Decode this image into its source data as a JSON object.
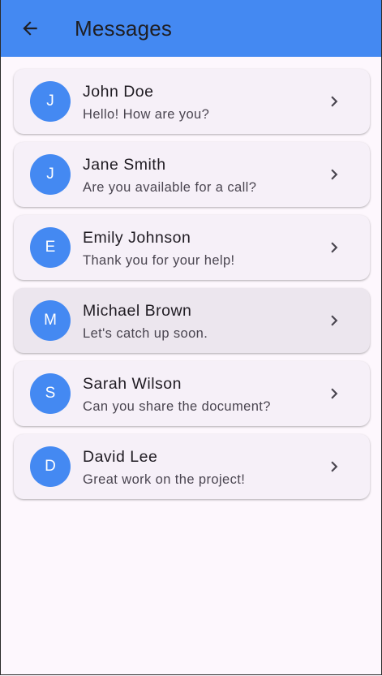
{
  "appbar": {
    "title": "Messages",
    "back_icon": "arrow-back-icon",
    "color": "#4489f2"
  },
  "colors": {
    "background": "#fdf7fd",
    "card": "#f6f0f8",
    "card_pressed": "#ece6ee",
    "avatar": "#4489f2"
  },
  "conversations": [
    {
      "initial": "J",
      "name": "John Doe",
      "preview": "Hello! How are you?"
    },
    {
      "initial": "J",
      "name": "Jane Smith",
      "preview": "Are you available for a call?"
    },
    {
      "initial": "E",
      "name": "Emily Johnson",
      "preview": "Thank you for your help!"
    },
    {
      "initial": "M",
      "name": "Michael Brown",
      "preview": "Let's catch up soon.",
      "pressed": true
    },
    {
      "initial": "S",
      "name": "Sarah Wilson",
      "preview": "Can you share the document?"
    },
    {
      "initial": "D",
      "name": "David Lee",
      "preview": "Great work on the project!"
    }
  ],
  "row_icon": "chevron-right-icon"
}
